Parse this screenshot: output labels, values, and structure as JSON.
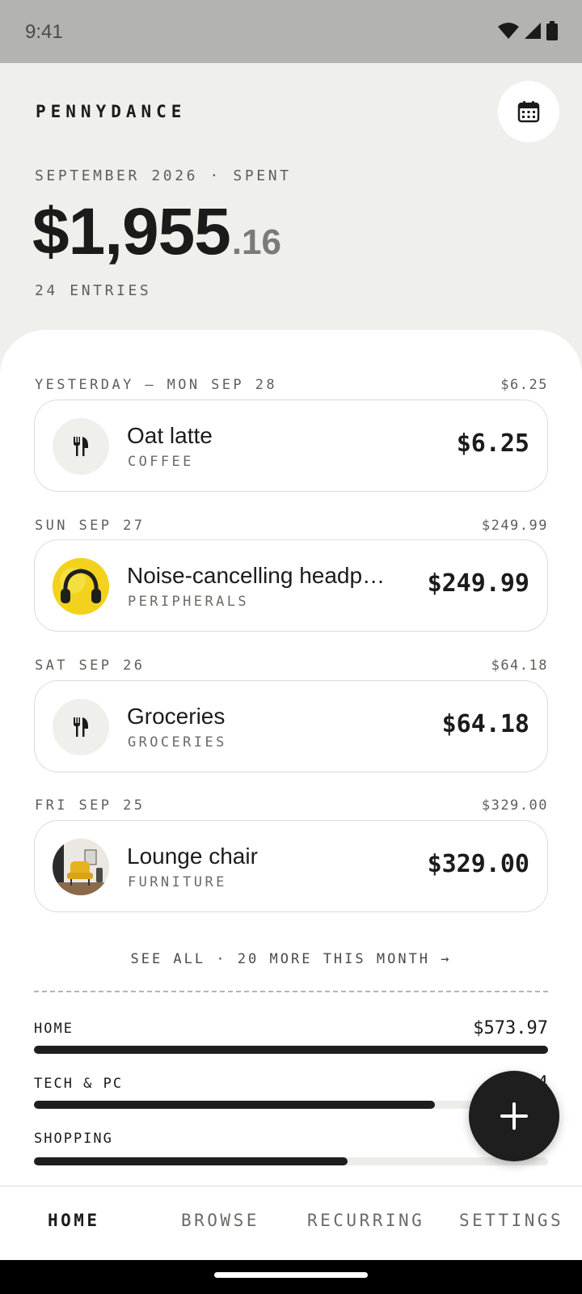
{
  "status": {
    "time": "9:41"
  },
  "header": {
    "brand": "PENNYDANCE",
    "period": "SEPTEMBER 2026 · SPENT",
    "total_main": "$1,955",
    "total_cents": ".16",
    "entries": "24 ENTRIES"
  },
  "days": [
    {
      "label": "YESTERDAY — MON SEP 28",
      "total": "$6.25",
      "item": {
        "title": "Oat latte",
        "category": "COFFEE",
        "amount": "$6.25",
        "icon": "fork-knife-icon"
      }
    },
    {
      "label": "SUN SEP 27",
      "total": "$249.99",
      "item": {
        "title": "Noise-cancelling headp…",
        "category": "PERIPHERALS",
        "amount": "$249.99",
        "icon": "headphones-thumbnail"
      }
    },
    {
      "label": "SAT SEP 26",
      "total": "$64.18",
      "item": {
        "title": "Groceries",
        "category": "GROCERIES",
        "amount": "$64.18",
        "icon": "fork-knife-icon"
      }
    },
    {
      "label": "FRI SEP 25",
      "total": "$329.00",
      "item": {
        "title": "Lounge chair",
        "category": "FURNITURE",
        "amount": "$329.00",
        "icon": "chair-thumbnail"
      }
    }
  ],
  "see_all": "SEE ALL · 20 MORE THIS MONTH →",
  "categories": [
    {
      "label": "HOME",
      "amount": "$573.97",
      "fraction": 1.0
    },
    {
      "label": "TECH & PC",
      "amount": "$4",
      "fraction": 0.78
    },
    {
      "label": "SHOPPING",
      "amount": "$",
      "fraction": 0.61
    }
  ],
  "nav": {
    "home": "HOME",
    "browse": "BROWSE",
    "recurring": "RECURRING",
    "settings": "SETTINGS"
  },
  "colors": {
    "accent": "#1e1e1e",
    "background": "#efefeb",
    "headphones": "#f2d21c"
  }
}
